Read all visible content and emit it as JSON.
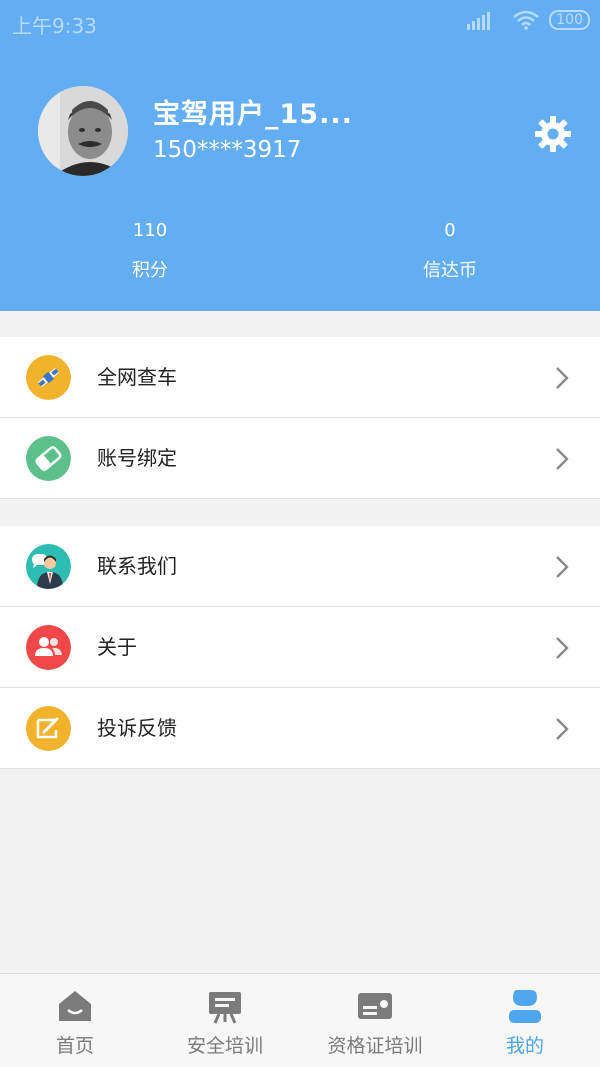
{
  "status_bar": {
    "time": "上午9:33",
    "battery": "100"
  },
  "profile": {
    "username": "宝驾用户_15...",
    "phone": "150****3917"
  },
  "stats": {
    "points": {
      "value": "110",
      "label": "积分"
    },
    "coins": {
      "value": "0",
      "label": "信达币"
    }
  },
  "menu": {
    "group1": [
      {
        "label": "全网查车",
        "icon": "satellite-icon",
        "color": "#f1b22c"
      },
      {
        "label": "账号绑定",
        "icon": "handshake-icon",
        "color": "#5cc08a"
      }
    ],
    "group2": [
      {
        "label": "联系我们",
        "icon": "customer-service-icon",
        "color": "#2dbdb3"
      },
      {
        "label": "关于",
        "icon": "people-icon",
        "color": "#f04848"
      },
      {
        "label": "投诉反馈",
        "icon": "edit-icon",
        "color": "#f1b22c"
      }
    ]
  },
  "tabbar": {
    "tabs": [
      {
        "label": "首页",
        "icon": "home-icon",
        "active": false
      },
      {
        "label": "安全培训",
        "icon": "training-board-icon",
        "active": false
      },
      {
        "label": "资格证培训",
        "icon": "certificate-icon",
        "active": false
      },
      {
        "label": "我的",
        "icon": "user-icon",
        "active": true
      }
    ]
  },
  "colors": {
    "header": "#63aef3",
    "active_tab": "#4ea6ee",
    "inactive_tab": "#7b7b7b"
  }
}
